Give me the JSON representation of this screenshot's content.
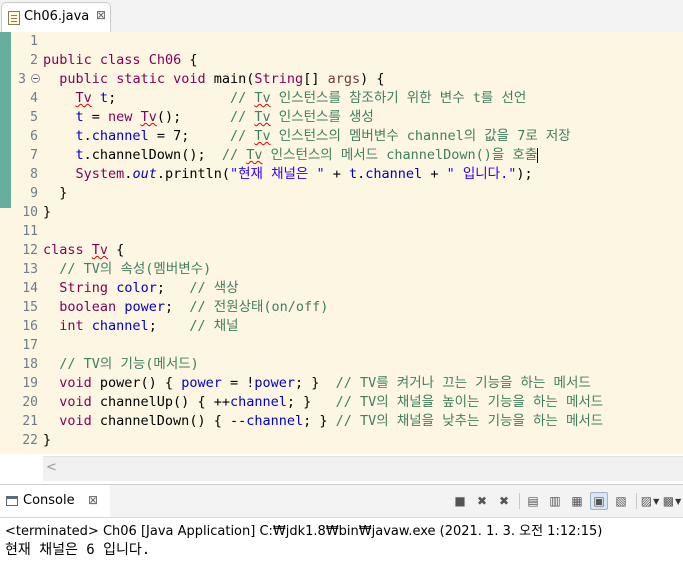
{
  "editor": {
    "tab": {
      "label": "Ch06.java",
      "close": "⊠"
    },
    "line_numbers": [
      "1",
      "2",
      "3",
      "4",
      "5",
      "6",
      "7",
      "8",
      "9",
      "10",
      "11",
      "12",
      "13",
      "14",
      "15",
      "16",
      "17",
      "18",
      "19",
      "20",
      "21",
      "22"
    ],
    "fold_line": "3",
    "code_lines": [
      "",
      "public class Ch06 {",
      "  public static void main(String[] args) {",
      "    Tv t;              // Tv 인스턴스를 참조하기 위한 변수 t를 선언",
      "    t = new Tv();      // Tv 인스턴스를 생성",
      "    t.channel = 7;     // Tv 인스턴스의 멤버변수 channel의 값을 7로 저장",
      "    t.channelDown();  // Tv 인스턴스의 메서드 channelDown()을 호출",
      "    System.out.println(\"현재 채널은 \" + t.channel + \" 입니다.\");",
      "  }",
      "}",
      "",
      "class Tv {",
      "  // TV의 속성(멤버변수)",
      "  String color;   // 색상",
      "  boolean power;  // 전원상태(on/off)",
      "  int channel;    // 채널",
      "",
      "  // TV의 기능(메서드)",
      "  void power() { power = !power; }  // TV를 켜거나 끄는 기능을 하는 메서드",
      "  void channelUp() { ++channel; }   // TV의 채널을 높이는 기능을 하는 메서드",
      "  void channelDown() { --channel; } // TV의 채널을 낮추는 기능을 하는 메서드",
      "}"
    ],
    "scroll_left": "<"
  },
  "console": {
    "tab_label": "Console",
    "tab_close": "⊠",
    "toolbar_icons": [
      "terminate-icon",
      "remove-launch-icon",
      "remove-all-icon",
      "scroll-lock-icon",
      "word-wrap-icon",
      "show-on-stdout-icon",
      "show-on-stderr-icon",
      "pin-console-icon",
      "display-console-icon",
      "open-console-icon"
    ],
    "terminated_line": "<terminated> Ch06 [Java Application] C:₩jdk1.8₩bin₩javaw.exe (2021. 1. 3. 오전 1:12:15)",
    "output_line": "현재 채널은 6 입니다."
  },
  "colors": {
    "keyword": "#7f0055",
    "comment": "#3f7f5f",
    "field": "#0000c0",
    "string": "#2a00ff",
    "line_highlight_bg": "#fdf6e3",
    "change_bar": "#3f9b8b"
  }
}
